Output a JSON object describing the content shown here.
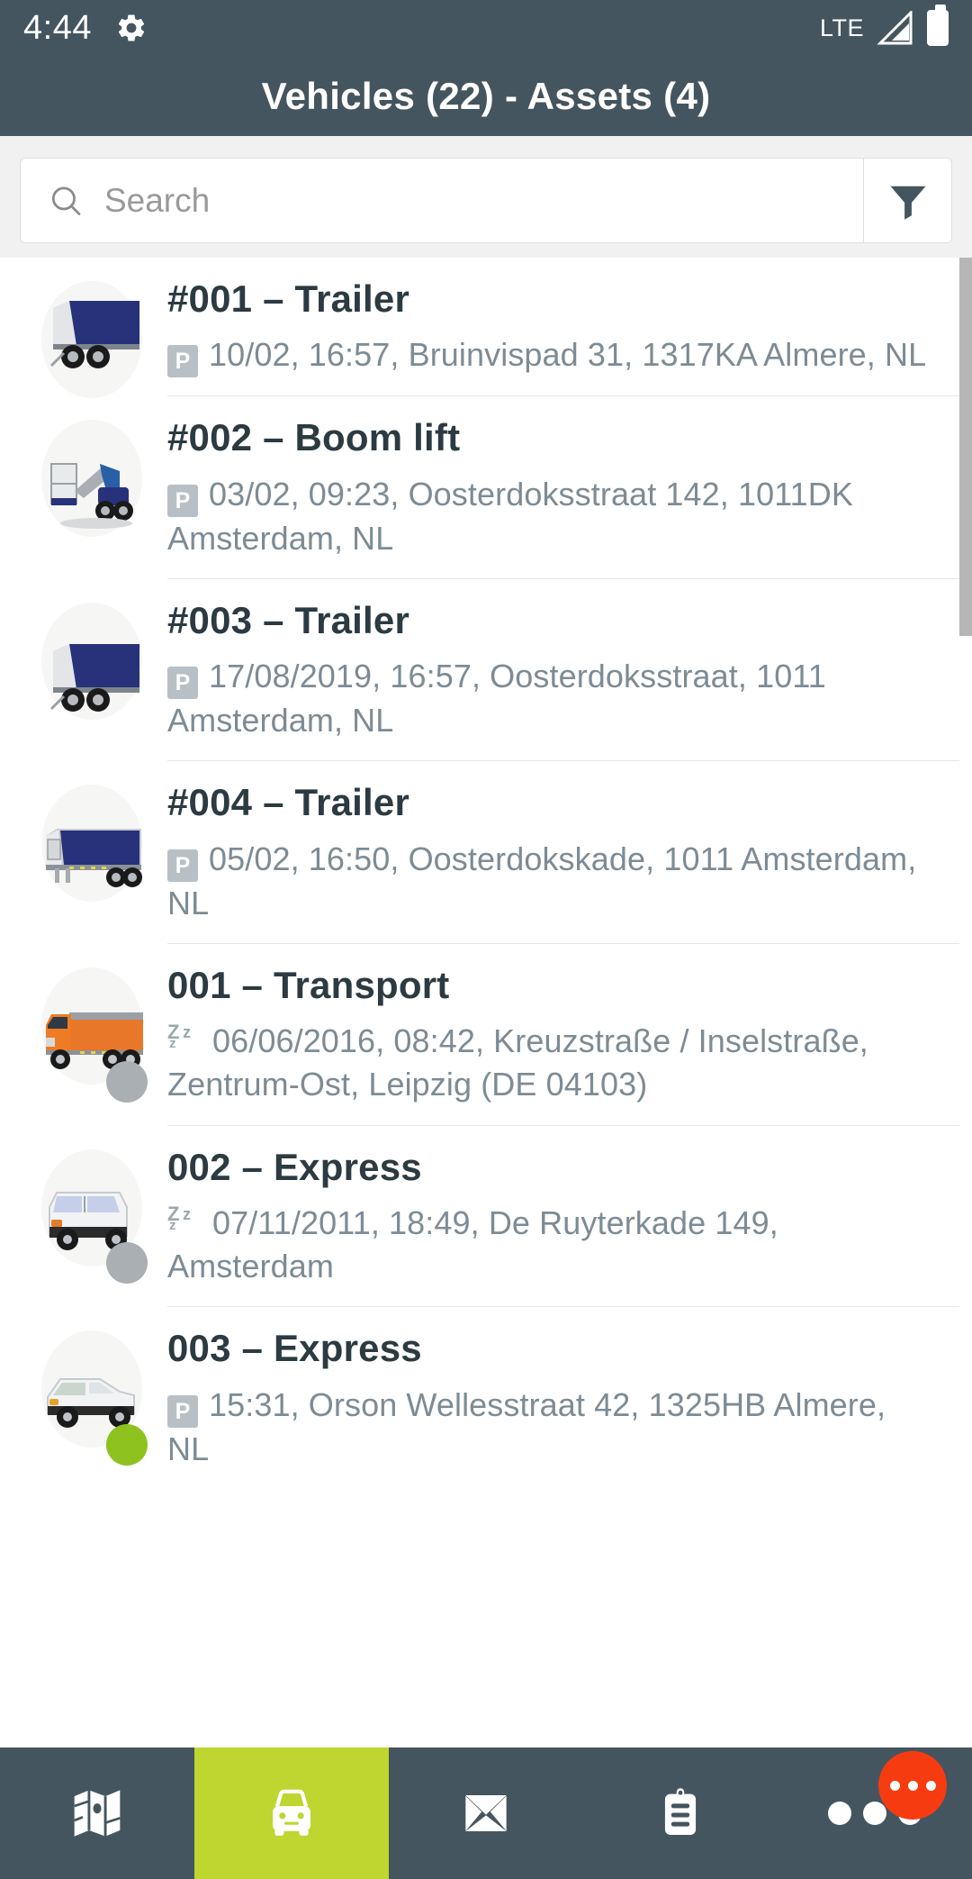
{
  "status_bar": {
    "time": "4:44",
    "gear_icon": "gear-icon",
    "network_label": "LTE",
    "signal_icon": "signal-icon",
    "battery_icon": "battery-full-icon"
  },
  "header": {
    "title": "Vehicles (22) - Assets (4)"
  },
  "search": {
    "placeholder": "Search",
    "value": "",
    "search_icon": "search-icon",
    "filter_icon": "filter-funnel-icon"
  },
  "colors": {
    "header_bg": "#45555F",
    "active_tab": "#BED62F",
    "badge_red": "#F73B11",
    "status_green": "#8DC21F",
    "status_gray": "#A9AFB3",
    "subtext": "#7D8B95",
    "title_text": "#2C3A42"
  },
  "list": {
    "items": [
      {
        "title": "#001 – Trailer",
        "state_icon": "parking-badge",
        "state_label": "P",
        "detail": "10/02, 16:57, Bruinvispad 31, 1317KA Almere, NL",
        "vehicle_icon": "box-trailer-icon",
        "status_dot": null
      },
      {
        "title": "#002 – Boom lift",
        "state_icon": "parking-badge",
        "state_label": "P",
        "detail": "03/02, 09:23, Oosterdoksstraat 142, 1011DK Amsterdam, NL",
        "vehicle_icon": "boom-lift-icon",
        "status_dot": null
      },
      {
        "title": "#003 – Trailer",
        "state_icon": "parking-badge",
        "state_label": "P",
        "detail": "17/08/2019, 16:57, Oosterdoksstraat, 1011 Amsterdam, NL",
        "vehicle_icon": "box-trailer-icon",
        "status_dot": null
      },
      {
        "title": "#004 – Trailer",
        "state_icon": "parking-badge",
        "state_label": "P",
        "detail": "05/02, 16:50, Oosterdokskade, 1011 Amsterdam, NL",
        "vehicle_icon": "semi-trailer-icon",
        "status_dot": null
      },
      {
        "title": "001 – Transport",
        "state_icon": "sleep-badge",
        "state_label": "Zz",
        "detail": "06/06/2016, 08:42, Kreuzstraße / Inselstraße, Zentrum-Ost, Leipzig (DE 04103)",
        "vehicle_icon": "orange-truck-icon",
        "status_dot": "#A9AFB3"
      },
      {
        "title": "002 – Express",
        "state_icon": "sleep-badge",
        "state_label": "Zz",
        "detail": "07/11/2011, 18:49, De Ruyterkade 149, Amsterdam",
        "vehicle_icon": "white-van-icon",
        "status_dot": "#A9AFB3"
      },
      {
        "title": "003 – Express",
        "state_icon": "parking-badge",
        "state_label": "P",
        "detail": "15:31, Orson Wellesstraat 42, 1325HB Almere, NL",
        "vehicle_icon": "white-car-icon",
        "status_dot": "#8DC21F"
      }
    ]
  },
  "bottom_nav": {
    "items": [
      {
        "name": "map",
        "icon": "map-icon",
        "active": false
      },
      {
        "name": "vehicles",
        "icon": "car-icon",
        "active": true
      },
      {
        "name": "messages",
        "icon": "envelope-icon",
        "active": false
      },
      {
        "name": "tasks",
        "icon": "clipboard-icon",
        "active": false
      },
      {
        "name": "more",
        "icon": "more-dots-icon",
        "active": false
      }
    ],
    "more_badge_icon": "more-badge-icon"
  }
}
